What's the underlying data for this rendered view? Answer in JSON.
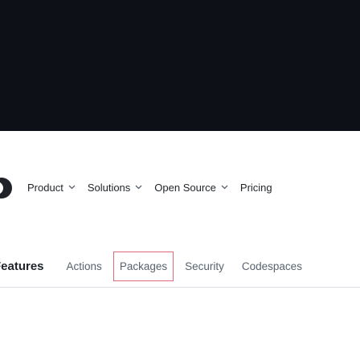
{
  "top_nav": {
    "items": [
      {
        "label": "Product",
        "has_dropdown": true,
        "icon": "chevron-down-icon"
      },
      {
        "label": "Solutions",
        "has_dropdown": true,
        "icon": "chevron-down-icon"
      },
      {
        "label": "Open Source",
        "has_dropdown": true,
        "icon": "chevron-down-icon"
      },
      {
        "label": "Pricing",
        "has_dropdown": false
      }
    ]
  },
  "feature_nav": {
    "title": "Features",
    "links": [
      "Actions",
      "Packages",
      "Security",
      "Codespaces"
    ],
    "highlighted": "Packages"
  },
  "colors": {
    "header_background": "#0d1117",
    "text": "#1f2328",
    "muted_text": "#59636e",
    "highlight_outline": "#e06b78"
  }
}
